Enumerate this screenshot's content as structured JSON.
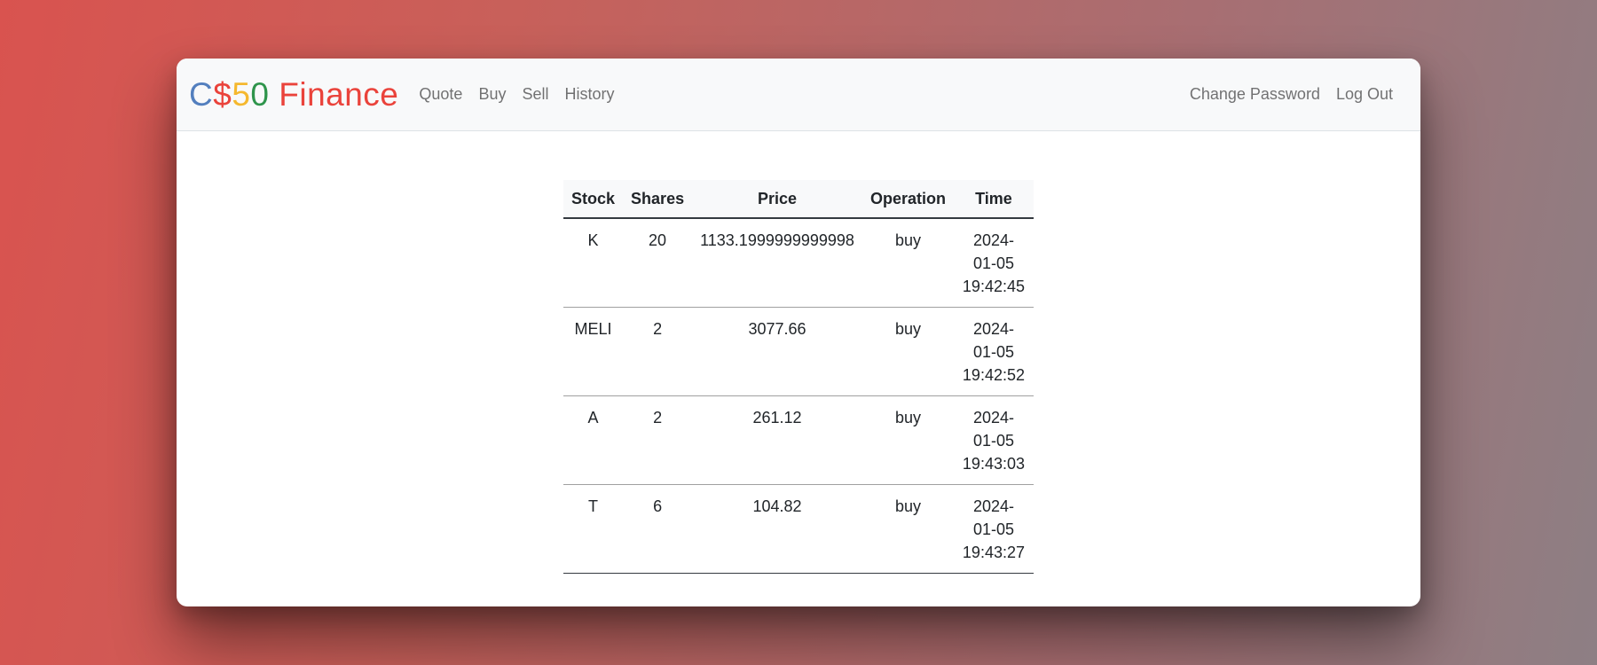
{
  "brand": {
    "c": "C",
    "dollar": "$",
    "five": "5",
    "zero": "0",
    "finance": " Finance"
  },
  "nav": {
    "left": [
      "Quote",
      "Buy",
      "Sell",
      "History"
    ],
    "right": [
      "Change Password",
      "Log Out"
    ]
  },
  "table": {
    "headers": [
      "Stock",
      "Shares",
      "Price",
      "Operation",
      "Time"
    ],
    "rows": [
      {
        "stock": "K",
        "shares": "20",
        "price": "1133.1999999999998",
        "operation": "buy",
        "time": [
          "2024-",
          "01-05",
          "19:42:45"
        ]
      },
      {
        "stock": "MELI",
        "shares": "2",
        "price": "3077.66",
        "operation": "buy",
        "time": [
          "2024-",
          "01-05",
          "19:42:52"
        ]
      },
      {
        "stock": "A",
        "shares": "2",
        "price": "261.12",
        "operation": "buy",
        "time": [
          "2024-",
          "01-05",
          "19:43:03"
        ]
      },
      {
        "stock": "T",
        "shares": "6",
        "price": "104.82",
        "operation": "buy",
        "time": [
          "2024-",
          "01-05",
          "19:43:27"
        ]
      }
    ]
  },
  "colors": {
    "brand_blue": "#537fbe",
    "brand_red": "#ea433b",
    "brand_yellow": "#f5b82e",
    "brand_green": "#2e944b"
  }
}
